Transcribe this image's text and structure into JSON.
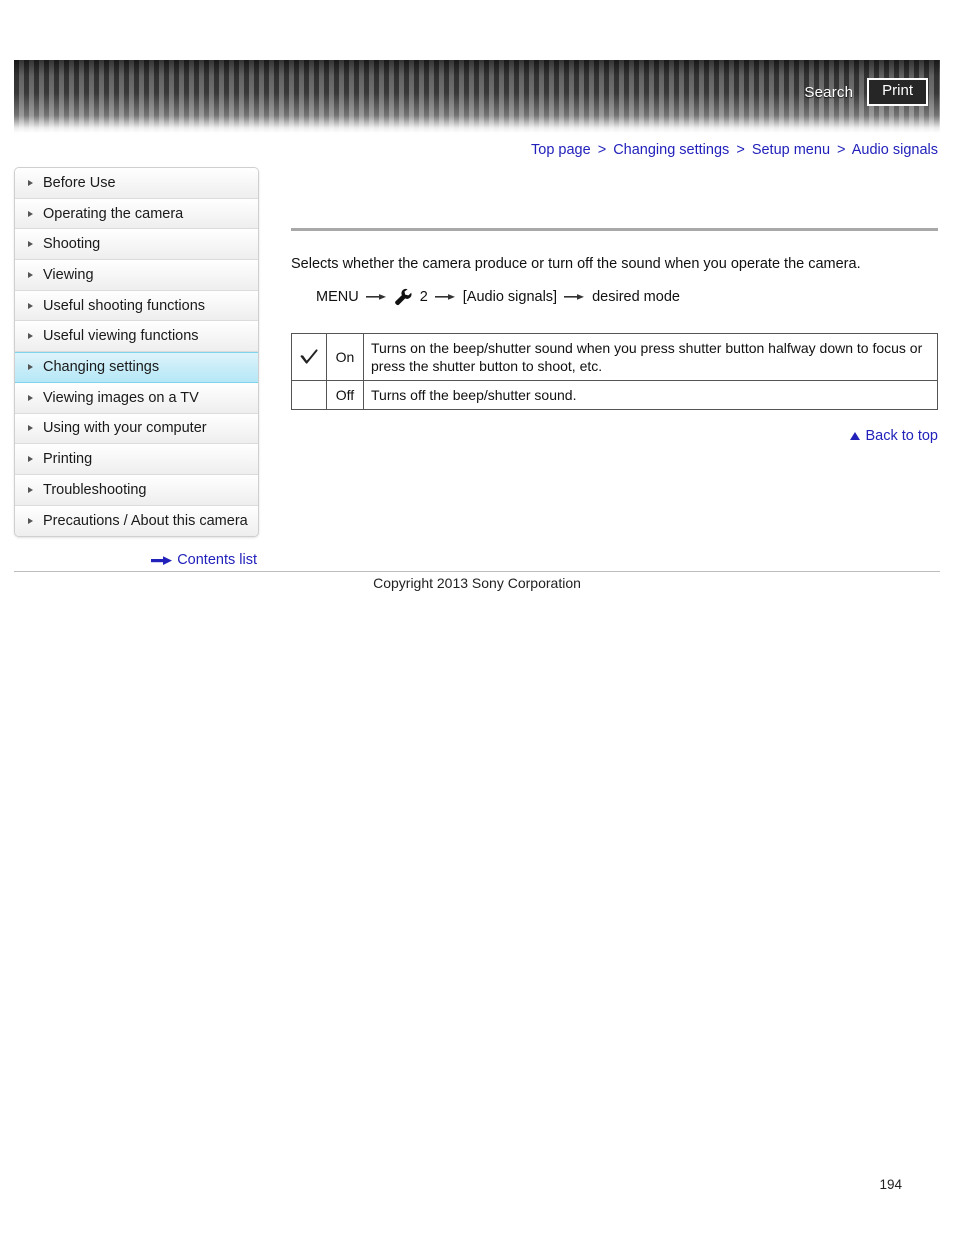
{
  "header": {
    "search_label": "Search",
    "print_label": "Print",
    "search_icon": "search-icon",
    "print_icon": "print-icon"
  },
  "breadcrumb": {
    "separator": ">",
    "items": [
      {
        "label": "Top page"
      },
      {
        "label": "Changing settings"
      },
      {
        "label": "Setup menu"
      },
      {
        "label": "Audio signals"
      }
    ]
  },
  "sidebar": {
    "items": [
      {
        "label": "Before Use",
        "active": false
      },
      {
        "label": "Operating the camera",
        "active": false
      },
      {
        "label": "Shooting",
        "active": false
      },
      {
        "label": "Viewing",
        "active": false
      },
      {
        "label": "Useful shooting functions",
        "active": false
      },
      {
        "label": "Useful viewing functions",
        "active": false
      },
      {
        "label": "Changing settings",
        "active": true
      },
      {
        "label": "Viewing images on a TV",
        "active": false
      },
      {
        "label": "Using with your computer",
        "active": false
      },
      {
        "label": "Printing",
        "active": false
      },
      {
        "label": "Troubleshooting",
        "active": false
      },
      {
        "label": "Precautions / About this camera",
        "active": false
      }
    ],
    "contents_list_label": "Contents list",
    "contents_list_icon": "arrow-right-icon"
  },
  "main": {
    "intro": "Selects whether the camera produce or turn off the sound when you operate the camera.",
    "menu_path": {
      "start": "MENU",
      "wrench_icon": "wrench-icon",
      "tab_number": "2",
      "item": "[Audio signals]",
      "end": "desired mode",
      "arrow_icon": "arrow-right-icon"
    },
    "options_table": {
      "default_marker_icon": "check-mark-icon",
      "rows": [
        {
          "is_default": true,
          "name": "On",
          "description": "Turns on the beep/shutter sound when you press shutter button halfway down to focus or press the shutter button to shoot, etc."
        },
        {
          "is_default": false,
          "name": "Off",
          "description": "Turns off the beep/shutter sound."
        }
      ]
    },
    "back_to_top": {
      "label": "Back to top",
      "icon": "triangle-up-icon"
    }
  },
  "footer": {
    "copyright": "Copyright 2013 Sony Corporation",
    "page_number": "194"
  },
  "colors": {
    "link": "#2222bb",
    "active_nav": "#c8edf8",
    "rule": "#a8a8a8"
  }
}
